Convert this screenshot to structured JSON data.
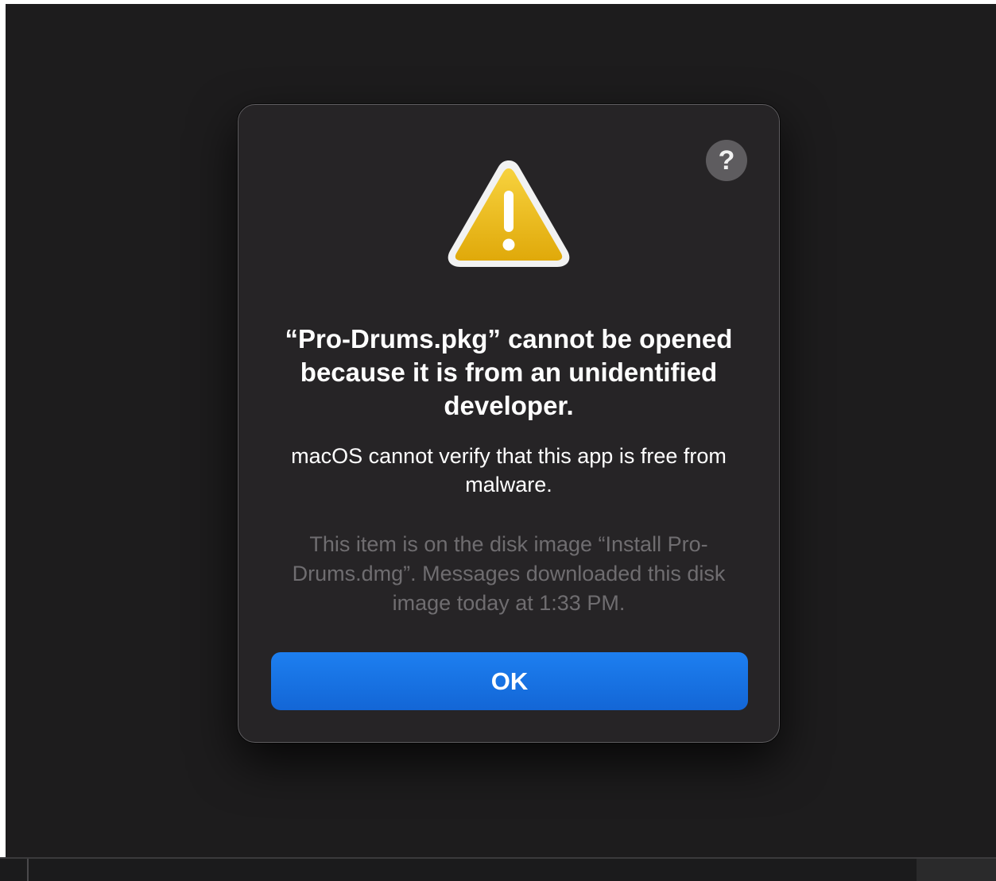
{
  "dialog": {
    "help_button_label": "?",
    "icon": "warning-icon",
    "title": "“Pro-Drums.pkg” cannot be opened because it is from an unidentified developer.",
    "message": "macOS cannot verify that this app is free from malware.",
    "info": "This item is on the disk image “Install Pro-Drums.dmg”. Messages downloaded this disk image today at 1:33 PM.",
    "ok_label": "OK"
  },
  "colors": {
    "background": "#1d1c1d",
    "dialog_background": "#262426",
    "accent": "#1a74e8",
    "warning_yellow": "#f0c419",
    "secondary_text": "#6f6d70"
  }
}
